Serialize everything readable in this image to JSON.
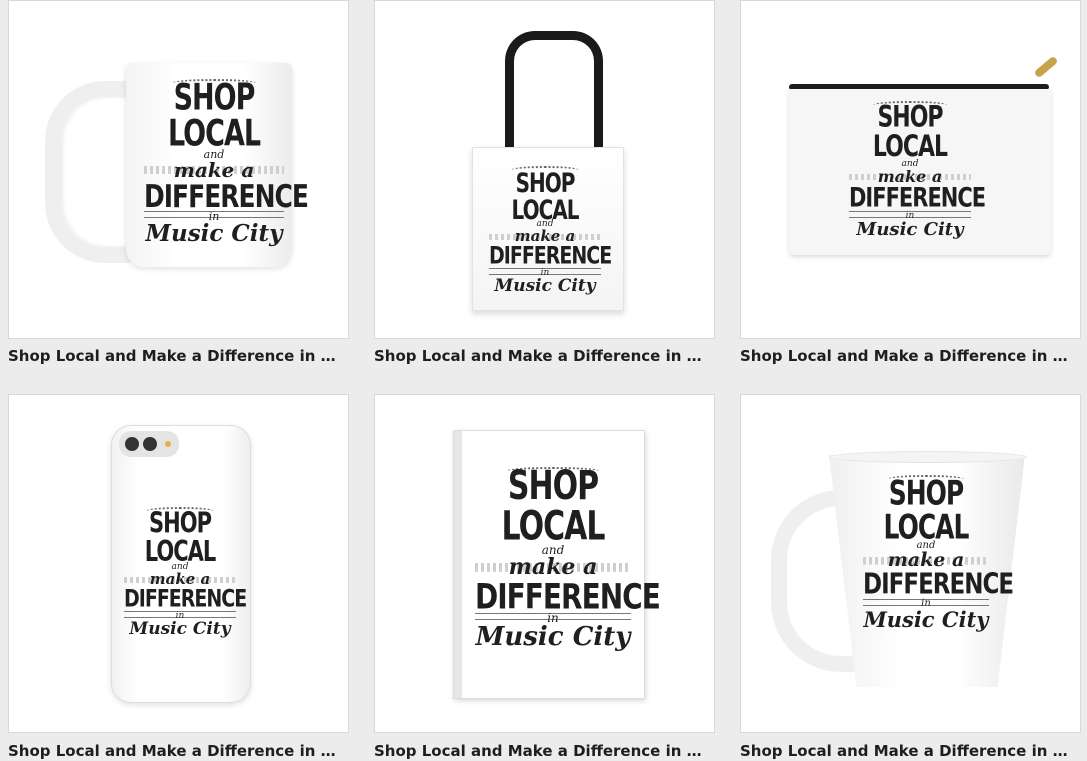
{
  "products": [
    {
      "title": "Shop Local and Make a Difference in Music City",
      "kind": "mug"
    },
    {
      "title": "Shop Local and Make a Difference in Music City",
      "kind": "tote-bag"
    },
    {
      "title": "Shop Local and Make a Difference in Music City",
      "kind": "zip-pouch"
    },
    {
      "title": "Shop Local and Make a Difference in Music City",
      "kind": "phone-case"
    },
    {
      "title": "Shop Local and Make a Difference in Music City",
      "kind": "notebook"
    },
    {
      "title": "Shop Local and Make a Difference in Music City",
      "kind": "latte-mug"
    }
  ],
  "design": {
    "line1": "SHOP LOCAL",
    "line2": "and",
    "line3": "make a",
    "line4": "DIFFERENCE",
    "line5": "in",
    "line6": "Music City"
  },
  "colors": {
    "background": "#ececec",
    "card": "#ffffff",
    "text": "#1e1e1e"
  }
}
